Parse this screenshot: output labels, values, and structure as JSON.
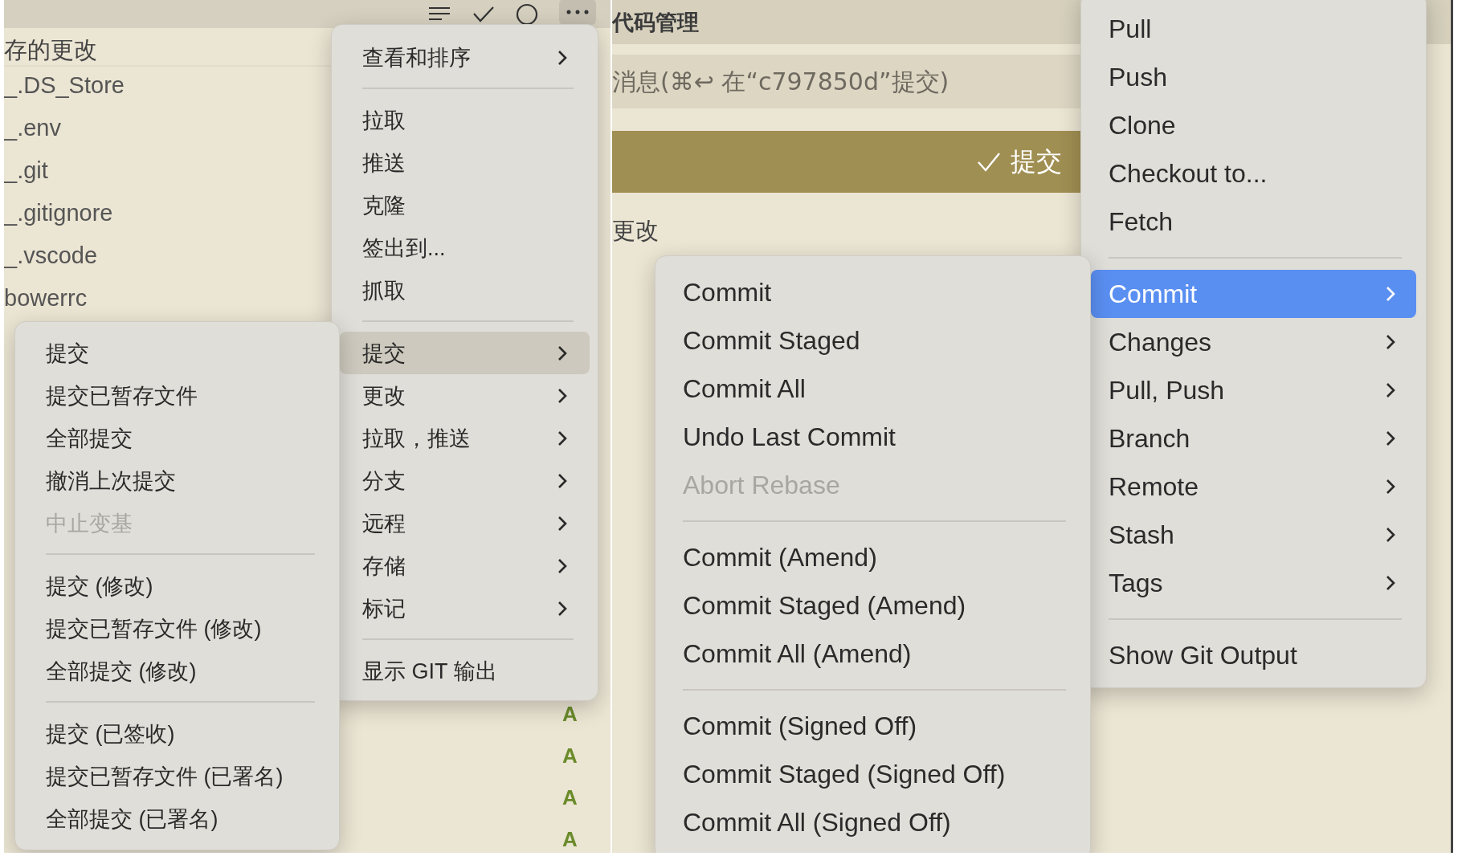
{
  "left_panel": {
    "more_button_pressed": true,
    "section_title": "存的更改",
    "files": [
      "_.DS_Store",
      "_.env",
      "_.git",
      "_.gitignore",
      "_.vscode",
      "bowerrc"
    ],
    "status_badges": [
      "A",
      "A",
      "A",
      "A"
    ],
    "menu": {
      "items": [
        {
          "kind": "item",
          "label": "查看和排序",
          "has_submenu": true,
          "selected": false,
          "disabled": false
        },
        {
          "kind": "separator"
        },
        {
          "kind": "item",
          "label": "拉取",
          "has_submenu": false,
          "selected": false,
          "disabled": false
        },
        {
          "kind": "item",
          "label": "推送",
          "has_submenu": false,
          "selected": false,
          "disabled": false
        },
        {
          "kind": "item",
          "label": "克隆",
          "has_submenu": false,
          "selected": false,
          "disabled": false
        },
        {
          "kind": "item",
          "label": "签出到...",
          "has_submenu": false,
          "selected": false,
          "disabled": false
        },
        {
          "kind": "item",
          "label": "抓取",
          "has_submenu": false,
          "selected": false,
          "disabled": false
        },
        {
          "kind": "separator"
        },
        {
          "kind": "item",
          "label": "提交",
          "has_submenu": true,
          "selected": true,
          "disabled": false
        },
        {
          "kind": "item",
          "label": "更改",
          "has_submenu": true,
          "selected": false,
          "disabled": false
        },
        {
          "kind": "item",
          "label": "拉取，推送",
          "has_submenu": true,
          "selected": false,
          "disabled": false
        },
        {
          "kind": "item",
          "label": "分支",
          "has_submenu": true,
          "selected": false,
          "disabled": false
        },
        {
          "kind": "item",
          "label": "远程",
          "has_submenu": true,
          "selected": false,
          "disabled": false
        },
        {
          "kind": "item",
          "label": "存储",
          "has_submenu": true,
          "selected": false,
          "disabled": false
        },
        {
          "kind": "item",
          "label": "标记",
          "has_submenu": true,
          "selected": false,
          "disabled": false
        },
        {
          "kind": "separator"
        },
        {
          "kind": "item",
          "label": "显示 GIT 输出",
          "has_submenu": false,
          "selected": false,
          "disabled": false
        }
      ]
    },
    "submenu": {
      "items": [
        {
          "kind": "item",
          "label": "提交",
          "has_submenu": false,
          "selected": false,
          "disabled": false
        },
        {
          "kind": "item",
          "label": "提交已暂存文件",
          "has_submenu": false,
          "selected": false,
          "disabled": false
        },
        {
          "kind": "item",
          "label": "全部提交",
          "has_submenu": false,
          "selected": false,
          "disabled": false
        },
        {
          "kind": "item",
          "label": "撤消上次提交",
          "has_submenu": false,
          "selected": false,
          "disabled": false
        },
        {
          "kind": "item",
          "label": "中止变基",
          "has_submenu": false,
          "selected": false,
          "disabled": true
        },
        {
          "kind": "separator"
        },
        {
          "kind": "item",
          "label": "提交 (修改)",
          "has_submenu": false,
          "selected": false,
          "disabled": false
        },
        {
          "kind": "item",
          "label": "提交已暂存文件 (修改)",
          "has_submenu": false,
          "selected": false,
          "disabled": false
        },
        {
          "kind": "item",
          "label": "全部提交 (修改)",
          "has_submenu": false,
          "selected": false,
          "disabled": false
        },
        {
          "kind": "separator"
        },
        {
          "kind": "item",
          "label": "提交 (已签收)",
          "has_submenu": false,
          "selected": false,
          "disabled": false
        },
        {
          "kind": "item",
          "label": "提交已暂存文件 (已署名)",
          "has_submenu": false,
          "selected": false,
          "disabled": false
        },
        {
          "kind": "item",
          "label": "全部提交 (已署名)",
          "has_submenu": false,
          "selected": false,
          "disabled": false
        }
      ]
    }
  },
  "right_panel": {
    "title": "代码管理",
    "message_placeholder": "消息(⌘↩ 在“c797850d”提交)",
    "commit_button": "提交",
    "section_title": "更改",
    "menu": {
      "items": [
        {
          "kind": "item",
          "label": "Pull",
          "has_submenu": false,
          "selected": false,
          "disabled": false
        },
        {
          "kind": "item",
          "label": "Push",
          "has_submenu": false,
          "selected": false,
          "disabled": false
        },
        {
          "kind": "item",
          "label": "Clone",
          "has_submenu": false,
          "selected": false,
          "disabled": false
        },
        {
          "kind": "item",
          "label": "Checkout to...",
          "has_submenu": false,
          "selected": false,
          "disabled": false
        },
        {
          "kind": "item",
          "label": "Fetch",
          "has_submenu": false,
          "selected": false,
          "disabled": false
        },
        {
          "kind": "separator"
        },
        {
          "kind": "item",
          "label": "Commit",
          "has_submenu": true,
          "selected": true,
          "disabled": false
        },
        {
          "kind": "item",
          "label": "Changes",
          "has_submenu": true,
          "selected": false,
          "disabled": false
        },
        {
          "kind": "item",
          "label": "Pull, Push",
          "has_submenu": true,
          "selected": false,
          "disabled": false
        },
        {
          "kind": "item",
          "label": "Branch",
          "has_submenu": true,
          "selected": false,
          "disabled": false
        },
        {
          "kind": "item",
          "label": "Remote",
          "has_submenu": true,
          "selected": false,
          "disabled": false
        },
        {
          "kind": "item",
          "label": "Stash",
          "has_submenu": true,
          "selected": false,
          "disabled": false
        },
        {
          "kind": "item",
          "label": "Tags",
          "has_submenu": true,
          "selected": false,
          "disabled": false
        },
        {
          "kind": "separator"
        },
        {
          "kind": "item",
          "label": "Show Git Output",
          "has_submenu": false,
          "selected": false,
          "disabled": false
        }
      ]
    },
    "submenu": {
      "items": [
        {
          "kind": "item",
          "label": "Commit",
          "has_submenu": false,
          "selected": false,
          "disabled": false
        },
        {
          "kind": "item",
          "label": "Commit Staged",
          "has_submenu": false,
          "selected": false,
          "disabled": false
        },
        {
          "kind": "item",
          "label": "Commit All",
          "has_submenu": false,
          "selected": false,
          "disabled": false
        },
        {
          "kind": "item",
          "label": "Undo Last Commit",
          "has_submenu": false,
          "selected": false,
          "disabled": false
        },
        {
          "kind": "item",
          "label": "Abort Rebase",
          "has_submenu": false,
          "selected": false,
          "disabled": true
        },
        {
          "kind": "separator"
        },
        {
          "kind": "item",
          "label": "Commit (Amend)",
          "has_submenu": false,
          "selected": false,
          "disabled": false
        },
        {
          "kind": "item",
          "label": "Commit Staged (Amend)",
          "has_submenu": false,
          "selected": false,
          "disabled": false
        },
        {
          "kind": "item",
          "label": "Commit All (Amend)",
          "has_submenu": false,
          "selected": false,
          "disabled": false
        },
        {
          "kind": "separator"
        },
        {
          "kind": "item",
          "label": "Commit (Signed Off)",
          "has_submenu": false,
          "selected": false,
          "disabled": false
        },
        {
          "kind": "item",
          "label": "Commit Staged (Signed Off)",
          "has_submenu": false,
          "selected": false,
          "disabled": false
        },
        {
          "kind": "item",
          "label": "Commit All (Signed Off)",
          "has_submenu": false,
          "selected": false,
          "disabled": false
        }
      ]
    }
  }
}
